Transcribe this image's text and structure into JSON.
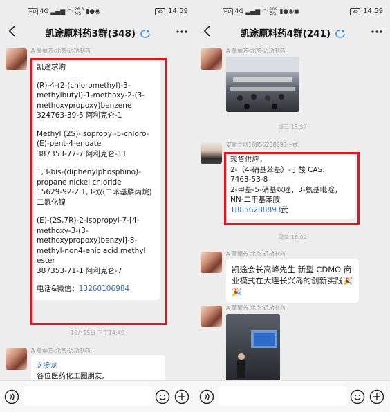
{
  "left": {
    "status": {
      "sig": "4G",
      "speed": "26.6\nK/s",
      "time": "14:59",
      "battery": "85"
    },
    "title": "凯途原料药3群(348)",
    "msg1": {
      "sender": "A 董丽芳-北京-迈劢制药",
      "paragraphs": [
        "凯途求购",
        "(R)-4-(2-(chloromethyl)-3-methylbutyl)-1-methoxy-2-(3-methoxypropoxy)benzene\n324763-39-5   阿利克仑-1",
        "Methyl (2S)-isopropyl-5-chloro-(E)-pent-4-enoate\n387353-77-7  阿利克仑-11",
        "1,3-bis-(diphenylphosphino)-propane nickel chloride\n15629-92-2  1,3-双(二苯基膦丙烷)二氯化镍",
        "(E)-(2S,7R)-2-Isopropyl-7-[4-methoxy-3-(3-methoxypropoxy)benzyl]-8-methyl-non4-enic acid methyl ester\n387353-71-1   阿利克仑-7"
      ],
      "contact_label": "电话&微信：",
      "contact_phone": "13260106984"
    },
    "timestamp": "10月15日 下午14:40",
    "msg2": {
      "sender": "A 董丽芳-北京-迈劢制药",
      "tag": "#接龙",
      "line": "各位医药化工圈朋友,"
    }
  },
  "right": {
    "status": {
      "sig": "4G",
      "speed": "109\nB/s",
      "time": "14:59",
      "battery": "85"
    },
    "title": "凯途原料药4群(241)",
    "msg1": {
      "sender": "A 董丽芳-北京-迈劢制药"
    },
    "timestamp1": "周三 15:57",
    "msg2": {
      "sender": "安徽立创18856288893～武",
      "lines": [
        "现货供应，",
        "2-（4-硝基苯基）-丁酸 CAS:",
        "7463-53-8",
        "2-甲基-5-硝基咪唑，3-氨基吡啶，",
        "NN-二甲基苯胺"
      ],
      "phone": "18856288893",
      "suffix": "武"
    },
    "timestamp2": "周三 16:02",
    "msg3": {
      "sender": "A 董丽芳-北京-迈劢制药",
      "text": "凯途会长高峰先生 新型 CDMO 商业模式在大连长兴岛的创新实践",
      "emoji": "🎉🎉"
    },
    "msg4": {
      "sender": "A 董丽芳-北京-迈劢制药"
    }
  }
}
